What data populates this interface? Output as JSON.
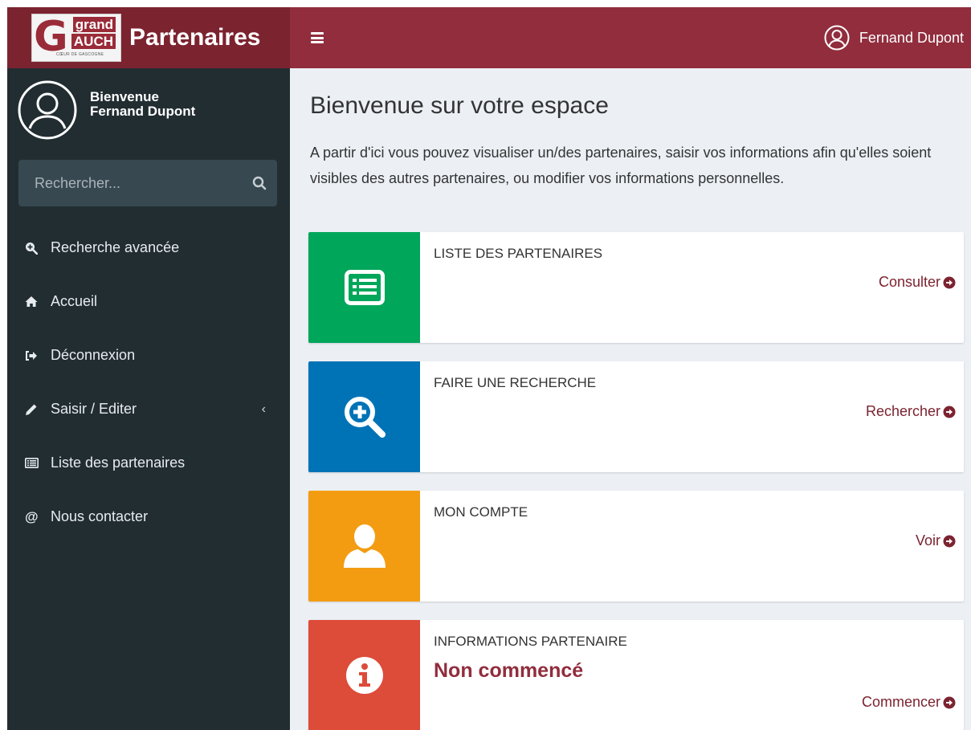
{
  "header": {
    "logo_text_grand": "grand",
    "logo_text_gauch": "AUCH",
    "logo_text_g": "G",
    "logo_tagline": "CŒUR DE GASCOGNE",
    "app_title": "Partenaires",
    "user_name": "Fernand Dupont"
  },
  "sidebar": {
    "welcome_label": "Bienvenue",
    "user_name": "Fernand Dupont",
    "search_placeholder": "Rechercher...",
    "items": [
      {
        "label": "Recherche avancée",
        "icon": "search-plus-icon"
      },
      {
        "label": "Accueil",
        "icon": "home-icon"
      },
      {
        "label": "Déconnexion",
        "icon": "sign-out-icon"
      },
      {
        "label": "Saisir / Editer",
        "icon": "pencil-icon",
        "chevron": "‹"
      },
      {
        "label": "Liste des partenaires",
        "icon": "list-icon"
      },
      {
        "label": "Nous contacter",
        "icon": "at-icon"
      }
    ]
  },
  "main": {
    "title": "Bienvenue sur votre espace",
    "intro": "A partir d'ici vous pouvez visualiser un/des partenaires, saisir vos informations afin qu'elles soient visibles des autres partenaires, ou modifier vos informations personnelles.",
    "cards": [
      {
        "title": "LISTE DES PARTENAIRES",
        "action": "Consulter",
        "color": "#00a65a",
        "icon": "list-icon"
      },
      {
        "title": "FAIRE UNE RECHERCHE",
        "action": "Rechercher",
        "color": "#0073b7",
        "icon": "search-plus-icon"
      },
      {
        "title": "MON COMPTE",
        "action": "Voir",
        "color": "#f39c12",
        "icon": "user-icon"
      },
      {
        "title": "INFORMATIONS PARTENAIRE",
        "status": "Non commencé",
        "action": "Commencer",
        "color": "#dd4b39",
        "icon": "info-icon"
      }
    ]
  },
  "colors": {
    "header_dark": "#7c2330",
    "header": "#912d3d",
    "sidebar": "#222d32",
    "background": "#ecf0f5"
  }
}
